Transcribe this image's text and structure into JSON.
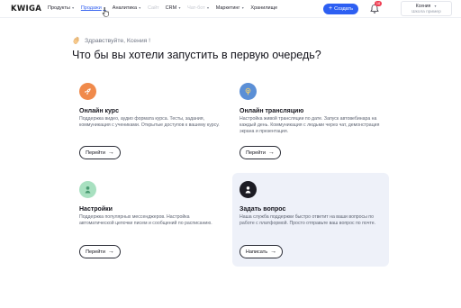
{
  "header": {
    "logo": "KWIGA",
    "nav": [
      {
        "label": "Продукты",
        "caret": true,
        "state": "normal"
      },
      {
        "label": "Продажи",
        "caret": true,
        "state": "active"
      },
      {
        "label": "Аналитика",
        "caret": true,
        "state": "normal"
      },
      {
        "label": "Сайт",
        "caret": false,
        "state": "dim"
      },
      {
        "label": "CRM",
        "caret": true,
        "state": "normal"
      },
      {
        "label": "Чат-бот",
        "caret": true,
        "state": "dim"
      },
      {
        "label": "Маркетинг",
        "caret": true,
        "state": "normal"
      },
      {
        "label": "Хранилище",
        "caret": false,
        "state": "normal"
      }
    ],
    "create_button": {
      "plus": "+",
      "label": "Создать"
    },
    "notifications_badge": "18",
    "account": {
      "name": "Ксения",
      "school": "Школа пример"
    }
  },
  "greeting": "Здравствуйте, Ксения !",
  "headline": "Что бы вы хотели запустить в первую очередь?",
  "cards": [
    {
      "title": "Онлайн курс",
      "description": "Поддержка видео, аудио формата курса. Тесты, задания, коммуникация с учениками. Открытые доступов к вашему курсу.",
      "button": "Перейти",
      "icon": "rocket-icon",
      "icon_color": "#f08a4b",
      "highlighted": false
    },
    {
      "title": "Онлайн трансляцию",
      "description": "Настройка живой трансляции по дате. Запуск автовебинара на каждый день. Коммуникация с людьми через чат, демонстрация экрана и презентация.",
      "button": "Перейти",
      "icon": "broadcast-icon",
      "icon_color": "#5b8fd6",
      "highlighted": false
    },
    {
      "title": "Настройки",
      "description": "Поддержка популярных мессенджеров. Настройка автоматической цепочки писем и сообщений по расписанию.",
      "button": "Перейти",
      "icon": "settings-icon",
      "icon_color": "#a8e0c0",
      "highlighted": false
    },
    {
      "title": "Задать вопрос",
      "description": "Наша служба поддержки быстро ответит на ваши вопросы по работе с платформой. Просто отправьте ваш вопрос по почте.",
      "button": "Написать",
      "icon": "support-icon",
      "icon_color": "#1c1c24",
      "highlighted": true
    }
  ]
}
